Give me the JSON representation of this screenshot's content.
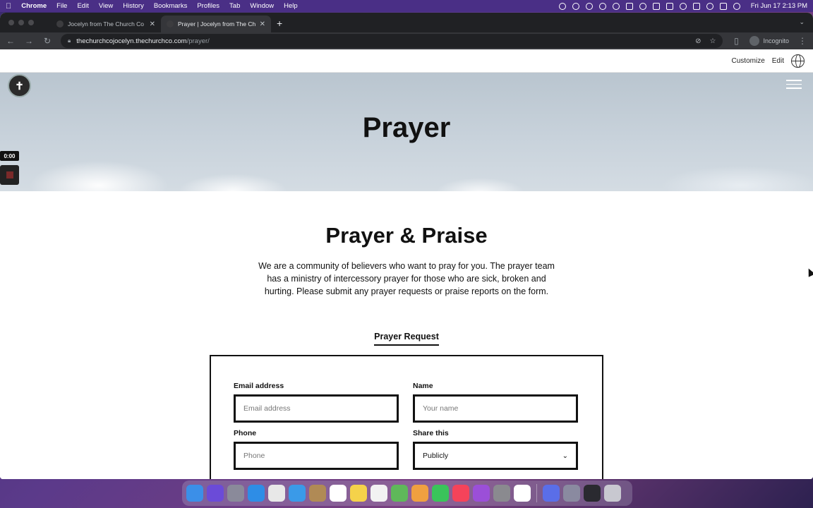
{
  "menubar": {
    "app_name": "Chrome",
    "menus": [
      "File",
      "Edit",
      "View",
      "History",
      "Bookmarks",
      "Profiles",
      "Tab",
      "Window",
      "Help"
    ],
    "clock": "Fri Jun 17  2:13 PM"
  },
  "browser": {
    "tabs": [
      {
        "title": "Jocelyn from The Church Co",
        "active": false
      },
      {
        "title": "Prayer | Jocelyn from The Chur",
        "active": true
      }
    ],
    "url_host": "thechurchcojocelyn.thechurchco.com",
    "url_path": "/prayer/",
    "profile_label": "Incognito"
  },
  "admin_bar": {
    "customize": "Customize",
    "edit": "Edit"
  },
  "hero": {
    "title": "Prayer"
  },
  "recorder": {
    "time": "0:00"
  },
  "section": {
    "heading": "Prayer & Praise",
    "description": "We are a community of believers who want to pray for you. The prayer team has a ministry of intercessory prayer for those who are sick, broken and hurting. Please submit any prayer requests or praise reports on the form.",
    "tab_label": "Prayer Request"
  },
  "form": {
    "email": {
      "label": "Email address",
      "placeholder": "Email address"
    },
    "name": {
      "label": "Name",
      "placeholder": "Your name"
    },
    "phone": {
      "label": "Phone",
      "placeholder": "Phone"
    },
    "share": {
      "label": "Share this",
      "value": "Publicly"
    }
  },
  "dock": {
    "apps": [
      {
        "icon": "finder-icon",
        "color": "#3b8fe8"
      },
      {
        "icon": "siri-icon",
        "color": "#6b4bd8"
      },
      {
        "icon": "launchpad-icon",
        "color": "#8a8a9a"
      },
      {
        "icon": "safari-icon",
        "color": "#2e8de6"
      },
      {
        "icon": "chrome-icon",
        "color": "#e8e8e8"
      },
      {
        "icon": "mail-icon",
        "color": "#3a9ae8"
      },
      {
        "icon": "contacts-icon",
        "color": "#b08a55"
      },
      {
        "icon": "calendar-icon",
        "color": "#ffffff"
      },
      {
        "icon": "notes-icon",
        "color": "#f5d24a"
      },
      {
        "icon": "reminders-icon",
        "color": "#f2f2f2"
      },
      {
        "icon": "maps-icon",
        "color": "#5fb85a"
      },
      {
        "icon": "photos-icon",
        "color": "#f0a040"
      },
      {
        "icon": "messages-icon",
        "color": "#3ac45a"
      },
      {
        "icon": "music-icon",
        "color": "#f5435a"
      },
      {
        "icon": "podcasts-icon",
        "color": "#9b4fd8"
      },
      {
        "icon": "settings-icon",
        "color": "#8a8a8f"
      },
      {
        "icon": "slack-icon",
        "color": "#ffffff"
      }
    ],
    "extras": [
      {
        "icon": "workspace-icon",
        "color": "#5a6ee8"
      },
      {
        "icon": "help-icon",
        "color": "#8a8aa0"
      },
      {
        "icon": "screen-icon",
        "color": "#2a2a30"
      },
      {
        "icon": "trash-icon",
        "color": "#c8c8d0"
      }
    ]
  }
}
